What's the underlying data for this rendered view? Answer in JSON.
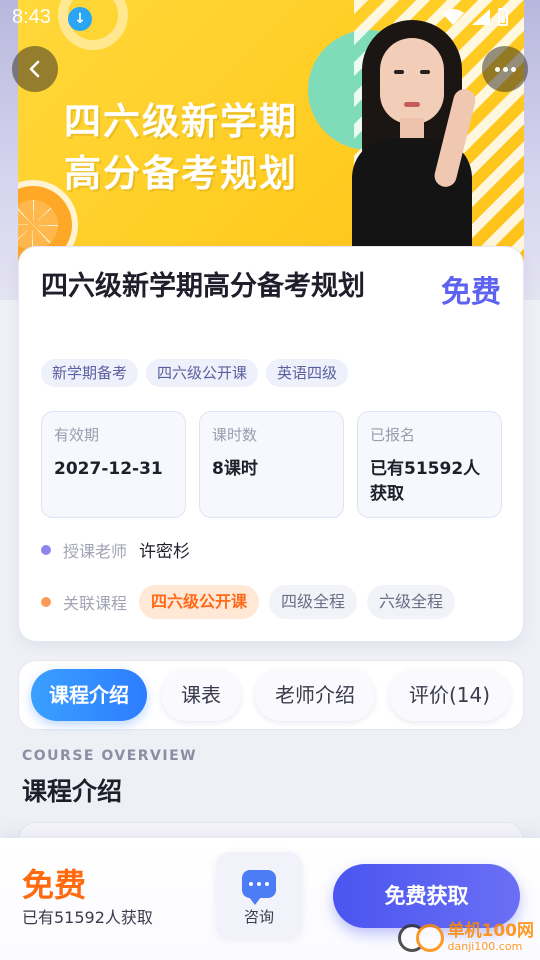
{
  "status_bar": {
    "time": "8:43"
  },
  "banner": {
    "title_line1": "四六级新学期",
    "title_line2": "高分备考规划"
  },
  "course": {
    "title": "四六级新学期高分备考规划",
    "price": "免费",
    "tags": [
      "新学期备考",
      "四六级公开课",
      "英语四级"
    ],
    "stats": [
      {
        "label": "有效期",
        "value": "2027-12-31"
      },
      {
        "label": "课时数",
        "value": "8课时"
      },
      {
        "label": "已报名",
        "value": "已有51592人获取"
      }
    ],
    "teacher_label": "授课老师",
    "teacher_name": "许密杉",
    "related_label": "关联课程",
    "related": [
      "四六级公开课",
      "四级全程",
      "六级全程"
    ]
  },
  "tabs": [
    "课程介绍",
    "课表",
    "老师介绍",
    "评价(14)"
  ],
  "overview": {
    "en": "COURSE OVERVIEW",
    "title": "课程介绍"
  },
  "bottom": {
    "price": "免费",
    "count": "已有51592人获取",
    "consult": "咨询",
    "cta": "免费获取"
  },
  "watermark": {
    "cn": "单机100网",
    "en": "danji100.com"
  },
  "colors": {
    "accent": "#5d63f0",
    "orange": "#ff6a10",
    "tab_active": "#2d7dff"
  }
}
